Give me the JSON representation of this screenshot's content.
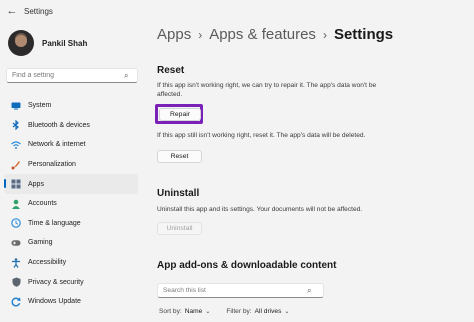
{
  "window": {
    "title": "Settings"
  },
  "profile": {
    "name": "Pankil Shah"
  },
  "sidebar": {
    "search_placeholder": "Find a setting",
    "items": [
      {
        "label": "System",
        "icon": "system-icon",
        "color": "#0f6cbd"
      },
      {
        "label": "Bluetooth & devices",
        "icon": "bluetooth-icon",
        "color": "#0f6cbd"
      },
      {
        "label": "Network & internet",
        "icon": "network-icon",
        "color": "#2f8fdd"
      },
      {
        "label": "Personalization",
        "icon": "personalization-icon",
        "color": "#d26a2a"
      },
      {
        "label": "Apps",
        "icon": "apps-icon",
        "color": "#5a6f86",
        "active": true
      },
      {
        "label": "Accounts",
        "icon": "accounts-icon",
        "color": "#2fa36b"
      },
      {
        "label": "Time & language",
        "icon": "time-language-icon",
        "color": "#2f8fdd"
      },
      {
        "label": "Gaming",
        "icon": "gaming-icon",
        "color": "#6b6b6b"
      },
      {
        "label": "Accessibility",
        "icon": "accessibility-icon",
        "color": "#1f6fb2"
      },
      {
        "label": "Privacy & security",
        "icon": "privacy-icon",
        "color": "#5d6670"
      },
      {
        "label": "Windows Update",
        "icon": "windows-update-icon",
        "color": "#1f7fd1"
      }
    ]
  },
  "breadcrumb": {
    "items": [
      "Apps",
      "Apps & features",
      "Settings"
    ]
  },
  "reset": {
    "title": "Reset",
    "repair_desc": "If this app isn't working right, we can try to repair it. The app's data won't be affected.",
    "repair_label": "Repair",
    "reset_desc": "If this app still isn't working right, reset it. The app's data will be deleted.",
    "reset_label": "Reset"
  },
  "uninstall": {
    "title": "Uninstall",
    "desc": "Uninstall this app and its settings. Your documents will not be affected.",
    "button_label": "Uninstall"
  },
  "addons": {
    "title": "App add-ons & downloadable content",
    "search_placeholder": "Search this list",
    "sort_label": "Sort by:",
    "sort_value": "Name",
    "filter_label": "Filter by:",
    "filter_value": "All drives"
  },
  "colors": {
    "accent": "#0067c0",
    "highlight": "#7a22b8"
  }
}
